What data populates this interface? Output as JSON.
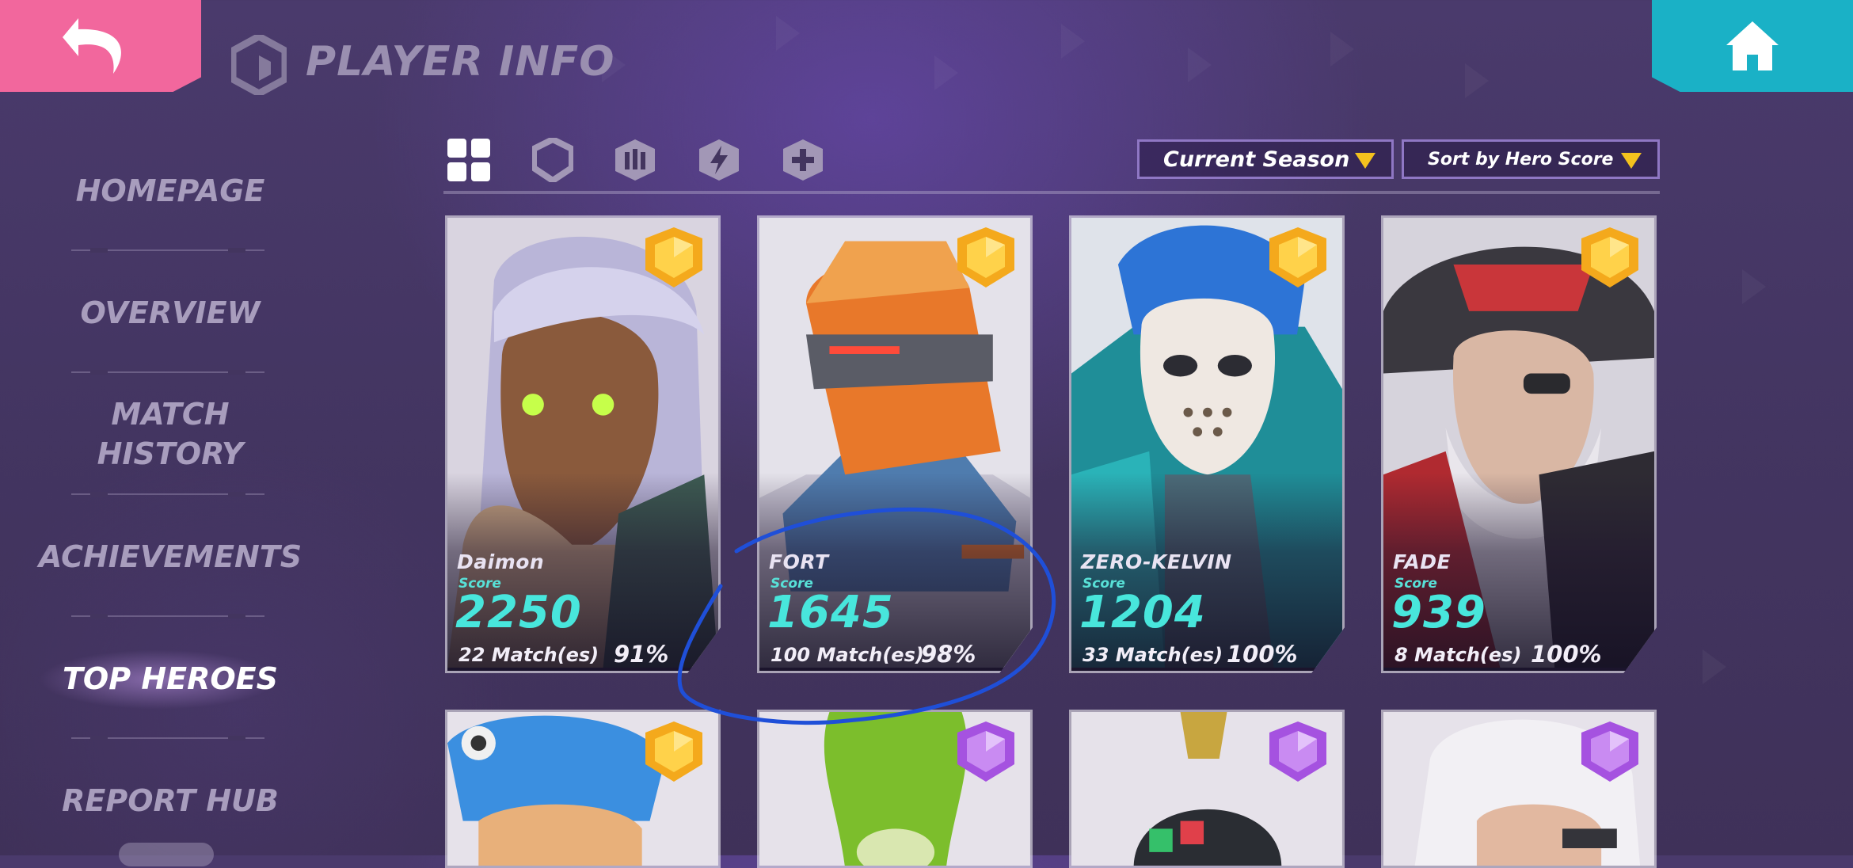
{
  "header": {
    "title": "PLAYER INFO",
    "back_icon": "back-arrow-icon",
    "home_icon": "home-icon"
  },
  "sidebar": {
    "items": [
      {
        "label": "HOMEPAGE",
        "active": false
      },
      {
        "label": "OVERVIEW",
        "active": false
      },
      {
        "label": "MATCH\nHISTORY",
        "active": false
      },
      {
        "label": "ACHIEVEMENTS",
        "active": false
      },
      {
        "label": "TOP HEROES",
        "active": true
      },
      {
        "label": "REPORT HUB",
        "active": false
      }
    ]
  },
  "filters": {
    "role_icons": [
      "grid-icon",
      "shield-icon",
      "bullets-icon",
      "lightning-icon",
      "plus-icon"
    ],
    "season": "Current Season",
    "sort": "Sort by Hero Score"
  },
  "heroes": [
    {
      "name": "Daimon",
      "score_label": "Score",
      "score": "2250",
      "matches": "22 Match(es)",
      "win_rate": "91%",
      "rank": "gold"
    },
    {
      "name": "FORT",
      "score_label": "Score",
      "score": "1645",
      "matches": "100 Match(es)",
      "win_rate": "98%",
      "rank": "gold"
    },
    {
      "name": "ZERO-KELVIN",
      "score_label": "Score",
      "score": "1204",
      "matches": "33 Match(es)",
      "win_rate": "100%",
      "rank": "gold"
    },
    {
      "name": "FADE",
      "score_label": "Score",
      "score": "939",
      "matches": "8 Match(es)",
      "win_rate": "100%",
      "rank": "gold"
    },
    {
      "rank": "gold"
    },
    {
      "rank": "purple"
    },
    {
      "rank": "purple"
    },
    {
      "rank": "purple"
    }
  ],
  "colors": {
    "back": "#f2679d",
    "home": "#1ab1c6",
    "score": "#48e6dc",
    "gold_badge": "#f4a91c",
    "purple_badge": "#a552e0",
    "annotation": "#1f4fd8"
  }
}
